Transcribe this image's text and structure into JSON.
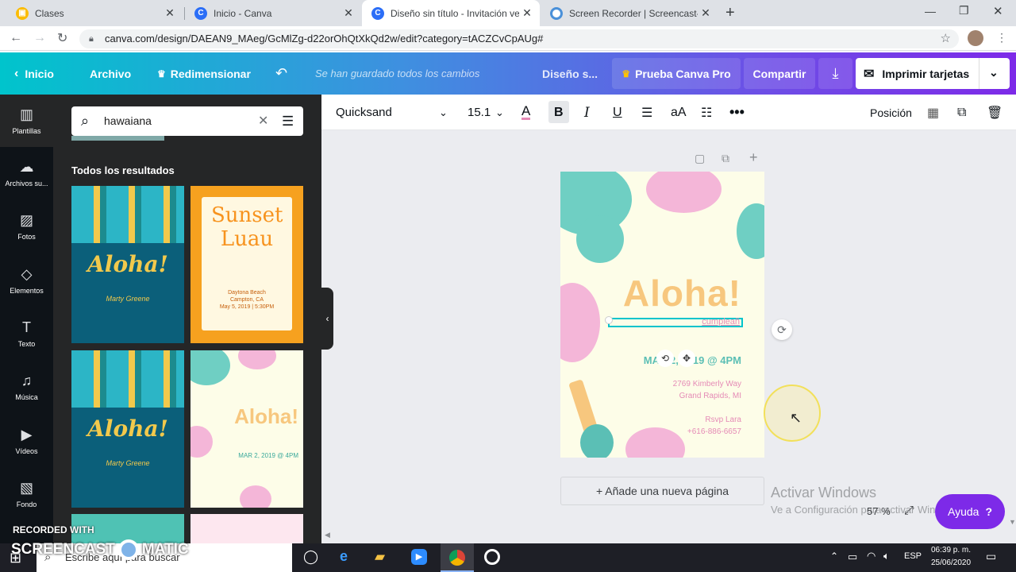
{
  "browser": {
    "tabs": [
      {
        "label": "Clases",
        "icon": "classroom-icon",
        "color": "#fbbc04"
      },
      {
        "label": "Inicio - Canva",
        "icon": "canva-icon",
        "color": "#2b6ef7"
      },
      {
        "label": "Diseño sin título - Invitación vert",
        "icon": "canva-icon",
        "color": "#2b6ef7"
      },
      {
        "label": "Screen Recorder | Screencast-O-",
        "icon": "screencast-icon",
        "color": "#4a90d9"
      }
    ],
    "url": "canva.com/design/DAEAN9_MAeg/GcMlZg-d22orOhQtXkQd2w/edit?category=tACZCvCpAUg#"
  },
  "header": {
    "home": "Inicio",
    "file": "Archivo",
    "resize": "Redimensionar",
    "saved": "Se han guardado todos los cambios",
    "title": "Diseño s...",
    "pro": "Prueba Canva Pro",
    "share": "Compartir",
    "print": "Imprimir tarjetas"
  },
  "rail": [
    {
      "label": "Plantillas",
      "icon": "templates-icon",
      "glyph": "▥"
    },
    {
      "label": "Archivos su...",
      "icon": "upload-icon",
      "glyph": "☁"
    },
    {
      "label": "Fotos",
      "icon": "photo-icon",
      "glyph": "▨"
    },
    {
      "label": "Elementos",
      "icon": "elements-icon",
      "glyph": "◇"
    },
    {
      "label": "Texto",
      "icon": "text-icon",
      "glyph": "T"
    },
    {
      "label": "Música",
      "icon": "music-icon",
      "glyph": "♫"
    },
    {
      "label": "Vídeos",
      "icon": "video-icon",
      "glyph": "▶"
    },
    {
      "label": "Fondo",
      "icon": "background-icon",
      "glyph": "▧"
    }
  ],
  "panel": {
    "search_value": "hawaiana",
    "results_heading": "Todos los resultados",
    "templates": [
      {
        "title": "Aloha!",
        "sub": "Marty Greene"
      },
      {
        "title": "Sunset Luau",
        "sub": "Daytona Beach\nCampton, CA\nMay 5, 2019 | 5:30PM"
      },
      {
        "title": "Aloha!",
        "sub": "Marty Greene"
      },
      {
        "title": "Aloha!",
        "sub": "MAR 2, 2019 @ 4PM"
      }
    ]
  },
  "toolbar": {
    "font": "Quicksand",
    "size": "15.1",
    "position": "Posición"
  },
  "design": {
    "title": "Aloha!",
    "selected_text": "cumpleañ",
    "date": "MAR 2, 2019 @ 4PM",
    "address1": "2769 Kimberly Way",
    "address2": "Grand Rapids, MI",
    "rsvp": "Rsvp Lara",
    "phone": "+616-886-6657"
  },
  "canvas": {
    "add_page": "+ Añade una nueva página",
    "zoom": "57 %",
    "help": "Ayuda",
    "help_q": "?",
    "watermark1": "Activar Windows",
    "watermark2": "Ve a Configuración para activar Windows."
  },
  "overlay": {
    "recorded": "RECORDED WITH",
    "brand": "SCREENCAST",
    "brand2": "MATIC"
  },
  "taskbar": {
    "search": "Escribe aquí para buscar",
    "lang": "ESP",
    "time": "06:39 p. m.",
    "date": "25/06/2020"
  },
  "colors": {
    "canva_teal": "#00c4cc",
    "canva_purple": "#7d2ae8",
    "design_bg": "#fdfde8",
    "aloha_orange": "#f7c77e",
    "teal_text": "#5bbfb5",
    "pink_text": "#e58bb6"
  }
}
